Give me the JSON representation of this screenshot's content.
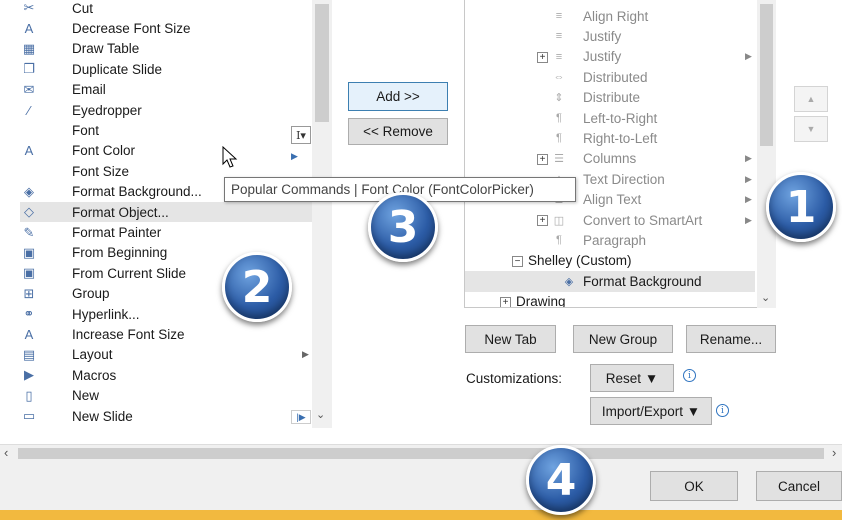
{
  "commands": [
    {
      "label": "Cut",
      "icon": "scissors-icon",
      "glyph": "✂"
    },
    {
      "label": "Decrease Font Size",
      "icon": "decrease-font-icon",
      "glyph": "A"
    },
    {
      "label": "Draw Table",
      "icon": "draw-table-icon",
      "glyph": "▦"
    },
    {
      "label": "Duplicate Slide",
      "icon": "duplicate-slide-icon",
      "glyph": "❐"
    },
    {
      "label": "Email",
      "icon": "email-icon",
      "glyph": "✉"
    },
    {
      "label": "Eyedropper",
      "icon": "eyedropper-icon",
      "glyph": "⁄"
    },
    {
      "label": "Font",
      "icon": "",
      "glyph": ""
    },
    {
      "label": "Font Color",
      "icon": "font-color-icon",
      "glyph": "A"
    },
    {
      "label": "Font Size",
      "icon": "",
      "glyph": ""
    },
    {
      "label": "Format Background...",
      "icon": "format-background-icon",
      "glyph": "◈"
    },
    {
      "label": "Format Object...",
      "icon": "format-object-icon",
      "glyph": "◇"
    },
    {
      "label": "Format Painter",
      "icon": "format-painter-icon",
      "glyph": "✎"
    },
    {
      "label": "From Beginning",
      "icon": "from-beginning-icon",
      "glyph": "▣"
    },
    {
      "label": "From Current Slide",
      "icon": "from-current-slide-icon",
      "glyph": "▣"
    },
    {
      "label": "Group",
      "icon": "group-icon",
      "glyph": "⊞"
    },
    {
      "label": "Hyperlink...",
      "icon": "hyperlink-icon",
      "glyph": "⚭"
    },
    {
      "label": "Increase Font Size",
      "icon": "increase-font-icon",
      "glyph": "A"
    },
    {
      "label": "Layout",
      "icon": "layout-icon",
      "glyph": "▤"
    },
    {
      "label": "Macros",
      "icon": "macros-icon",
      "glyph": "▶"
    },
    {
      "label": "New",
      "icon": "new-icon",
      "glyph": "▯"
    },
    {
      "label": "New Slide",
      "icon": "new-slide-icon",
      "glyph": "▭"
    }
  ],
  "buttons": {
    "add": "Add >>",
    "remove": "<< Remove",
    "new_tab": "New Tab",
    "new_group": "New Group",
    "rename": "Rename...",
    "reset": "Reset ▼",
    "import_export": "Import/Export ▼",
    "ok": "OK",
    "cancel": "Cancel"
  },
  "customizations_label": "Customizations:",
  "tooltip": "Popular Commands | Font Color (FontColorPicker)",
  "tree": [
    {
      "label": "Align Right",
      "icon": "align-right-icon",
      "glyph": "≡",
      "indent": 2
    },
    {
      "label": "Justify",
      "icon": "justify-icon",
      "glyph": "≡",
      "indent": 2
    },
    {
      "label": "Justify",
      "icon": "justify-icon",
      "glyph": "≡",
      "indent": 2,
      "expand": "+",
      "arrow": true
    },
    {
      "label": "Distributed",
      "icon": "distributed-icon",
      "glyph": "⇔",
      "indent": 2
    },
    {
      "label": "Distribute",
      "icon": "distribute-icon",
      "glyph": "⇕",
      "indent": 2
    },
    {
      "label": "Left-to-Right",
      "icon": "ltr-icon",
      "glyph": "¶",
      "indent": 2
    },
    {
      "label": "Right-to-Left",
      "icon": "rtl-icon",
      "glyph": "¶",
      "indent": 2
    },
    {
      "label": "Columns",
      "icon": "columns-icon",
      "glyph": "☰",
      "indent": 2,
      "expand": "+",
      "arrow": true
    },
    {
      "label": "Text Direction",
      "icon": "text-direction-icon",
      "glyph": "↕",
      "indent": 2,
      "arrow": true
    },
    {
      "label": "Align Text",
      "icon": "align-text-icon",
      "glyph": "≣",
      "indent": 2,
      "arrow": true
    },
    {
      "label": "Convert to SmartArt",
      "icon": "smartart-icon",
      "glyph": "◫",
      "indent": 2,
      "expand": "+",
      "arrow": true
    },
    {
      "label": "Paragraph",
      "icon": "paragraph-icon",
      "glyph": "¶",
      "indent": 2
    },
    {
      "label": "Shelley (Custom)",
      "icon": "",
      "glyph": "",
      "indent": 0,
      "expand": "−",
      "active": true
    },
    {
      "label": "Format Background",
      "icon": "format-background-icon",
      "glyph": "◈",
      "indent": 1,
      "active": true,
      "selected": true
    },
    {
      "label": "Drawing",
      "icon": "",
      "glyph": "",
      "indent": -1,
      "expand": "+",
      "active": true
    }
  ],
  "badges": [
    "1",
    "2",
    "3",
    "4"
  ],
  "colors": {
    "accent": "#f2b93f",
    "badge": "#2c5ca6",
    "selected_row": "#e5e5e5"
  }
}
